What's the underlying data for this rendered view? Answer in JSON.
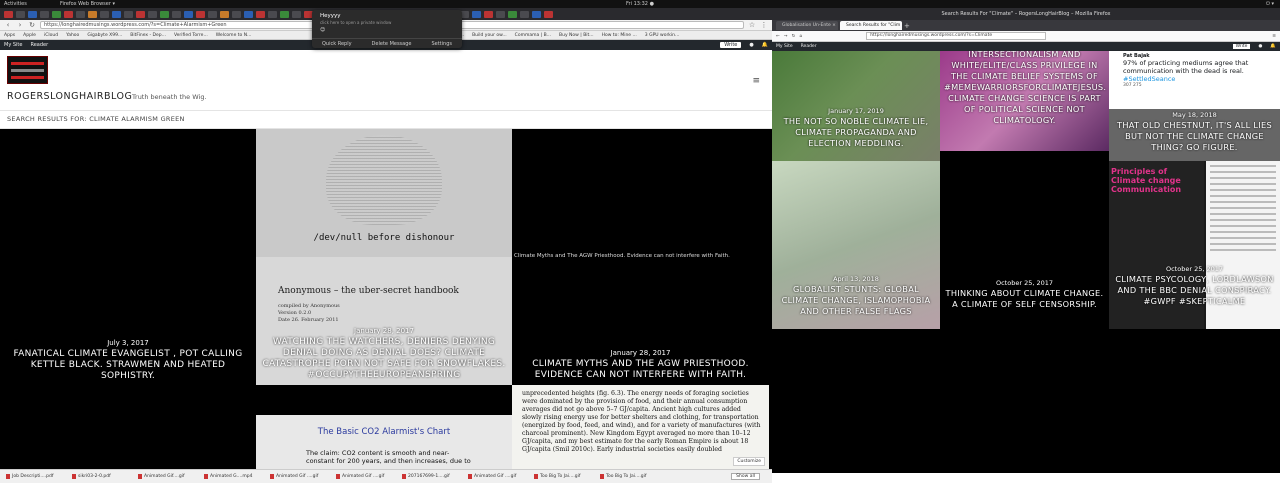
{
  "topbar": {
    "activities": "Activities",
    "app": "Firefox Web Browser ▾",
    "clock": "Fri 13:32 ●"
  },
  "left": {
    "url": "https://longhairedmusings.wordpress.com/?s=Climate+Alarmism+Green",
    "bookmarks": [
      "Apps",
      "Apple",
      "iCloud",
      "Yahoo",
      "Gigabyte X99...",
      "BitFinex - Dep...",
      "Verified Torre...",
      "Welcome to N...",
      "HOW TO SET ...",
      "Build your ow...",
      "Commama | B...",
      "Buy Now | Bit...",
      "How to: Mine ...",
      "3 GPU workin..."
    ],
    "wpbar": {
      "mysite": "My Site",
      "reader": "Reader",
      "write": "Write"
    },
    "notification": {
      "title": "Heyyyy",
      "subtitle": "click here to open a private window",
      "emoji": "😊",
      "actions": [
        "Quick Reply",
        "Delete Message",
        "Settings"
      ]
    },
    "site": {
      "title": "ROGERSLONGHAIRBLOG",
      "tagline": "Truth beneath the Wig.",
      "search_heading": "SEARCH RESULTS FOR: CLIMATE ALARMISM GREEN"
    },
    "posts": [
      {
        "date": "July 3, 2017",
        "title": "FANATICAL CLIMATE EVANGELIST , POT CALLING KETTLE BLACK. STRAWMEN AND HEATED SOPHISTRY."
      },
      {
        "date": "January 28, 2017",
        "title": "WATCHING THE WATCHERS, DENIERS DENYING DENIAL DOING AS DENIAL DOES? CLIMATE CATASTROPHE PORN NOT SAFE FOR SNOWFLAKES. #OCCUPYTHEEUROPEANSPRING"
      },
      {
        "date": "January 28, 2017",
        "title": "CLIMATE MYTHS AND THE AGW PRIESTHOOD. EVIDENCE CAN NOT INTERFERE WITH FAITH."
      }
    ],
    "image_text": {
      "devnull": "/dev/null before dishonour",
      "handbook": "Anonymous – the uber-secret handbook",
      "handbook_meta": [
        "compiled by Anonymous",
        "Version 0.2.0",
        "Date 26. February 2011"
      ],
      "missing_alt": "Climate Myths and The AGW Priesthood. Evidence can not interfere with Faith.",
      "chart_title": "The Basic CO2 Alarmist's Chart",
      "chart_claim": "The claim:  CO2 content is smooth and near-constant for 200 years, and then increases, due to",
      "paragraph": "unprecedented heights (fig. 6.3). The energy needs of foraging societies were dominated by the provision of food, and their annual consumption averages did not go above 5–7 GJ/capita. Ancient high cultures added slowly rising energy use for better shelters and clothing, for transportation (energized by food, feed, and wind), and for a variety of manufactures (with charcoal prominent). New Kingdom Egypt averaged no more than 10–12 GJ/capita, and my best estimate for the early Roman Empire is about 18 GJ/capita (Smil 2010c). Early industrial societies easily doubled",
      "customize": "Customize"
    },
    "downloads": [
      "Job Descripti....pdf",
      "sikri03-2-0.pdf",
      "Animated Gif....gif",
      "Animated G....mp4",
      "Animated Gif ....gif",
      "Animated Gif ....gif",
      "2071676­99-1....gif",
      "Animated Gif ....gif",
      "Too Big To Jai....gif",
      "Too Big To Jai....gif"
    ],
    "show_all": "Show all"
  },
  "right": {
    "window_title": "Search Results For \"Climate\" – RogersLongHairBlog – Mozilla Firefox",
    "tabs": [
      "Globalisation Un-Ente ×",
      "Search Results for \"Clim ×"
    ],
    "url": "https://longhairedmusings.wordpress.com/?s=Climate",
    "wpbar": {
      "mysite": "My Site",
      "reader": "Reader",
      "write": "Write"
    },
    "tweet": {
      "name": "Pat Bajak",
      "text": "97% of practicing mediums agree that communication with the dead is real.",
      "hashtag": "#SettledSeance",
      "stats": "307   275"
    },
    "pink_text": "Principles of\nClimate change\nCommunication",
    "posts": [
      {
        "date": "January 17, 2019",
        "title": "THE NOT SO NOBLE CLIMATE LIE, CLIMATE PROPAGANDA AND ELECTION MEDDLING."
      },
      {
        "date": "",
        "title": "INTERSECTIONALISM AND WHITE/ELITE/CLASS PRIVILEGE IN THE CLIMATE BELIEF SYSTEMS OF #MEMEWARRIORSFORCLIMATEJESUS. CLIMATE CHANGE SCIENCE IS PART OF POLITICAL SCIENCE NOT CLIMATOLOGY."
      },
      {
        "date": "May 18, 2018",
        "title": "THAT OLD CHESTNUT, IT'S ALL LIES BUT NOT THE CLIMATE CHANGE THING? GO FIGURE."
      },
      {
        "date": "April 13, 2018",
        "title": "GLOBALIST STUNTS: GLOBAL CLIMATE CHANGE, ISLAMOPHOBIA AND OTHER FALSE FLAGS"
      },
      {
        "date": "October 25, 2017",
        "title": "THINKING ABOUT CLIMATE CHANGE. A CLIMATE OF SELF CENSORSHIP."
      },
      {
        "date": "October 25, 2017",
        "title": "CLIMATE PSYCOLOGY, LORDLAWSON AND THE BBC DENIAL CONSPIRACY. #GWPF #SKEPTICALME"
      }
    ]
  }
}
